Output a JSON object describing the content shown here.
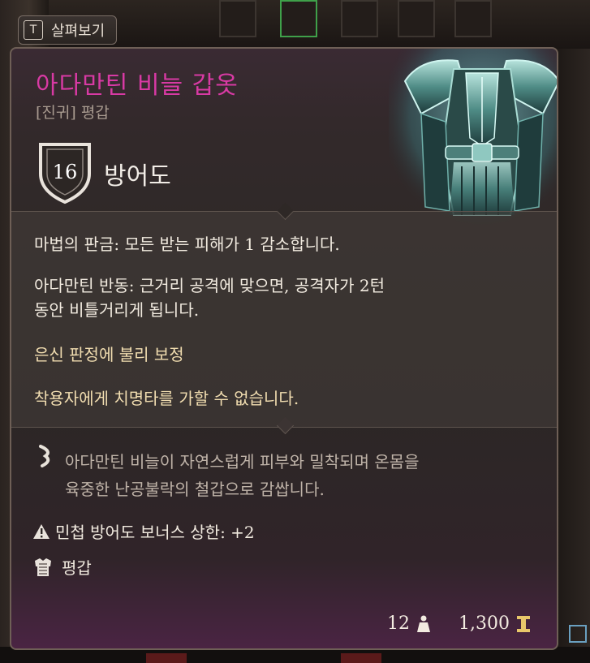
{
  "inspect_hint": {
    "key": "T",
    "label": "살펴보기"
  },
  "item": {
    "name": "아다만틴 비늘 갑옷",
    "rarity_type": "[진귀] 평갑",
    "armor_class": "16",
    "armor_label": "방어도",
    "properties": [
      "마법의 판금: 모든 받는 피해가 1 감소합니다.",
      "아다만틴 반동: 근거리 공격에 맞으면, 공격자가 2턴",
      "동안 비틀거리게 됩니다.",
      "은신 판정에 불리 보정",
      "착용자에게 치명타를 가할 수 없습니다."
    ],
    "flavor_lines": [
      "아다만틴 비늘이 자연스럽게 피부와 밀착되며 온몸을",
      "육중한 난공불락의 철갑으로 감쌉니다."
    ],
    "dex_cap": "민첩 방어도 보너스 상한: +2",
    "armor_type": "평갑",
    "weight": "12",
    "value": "1,300"
  },
  "icons": {
    "inspect": "keycap-t-icon",
    "shield": "shield-icon",
    "flavor": "quill-icon",
    "warning": "warning-icon",
    "armor_type": "chest-armor-icon",
    "weight": "weight-icon",
    "gold": "gold-coin-icon"
  },
  "colors": {
    "rarity": "#d83aa4",
    "property_highlight": "#f1ddb0",
    "text": "#f2ebe0",
    "muted": "#bfb3a8"
  }
}
